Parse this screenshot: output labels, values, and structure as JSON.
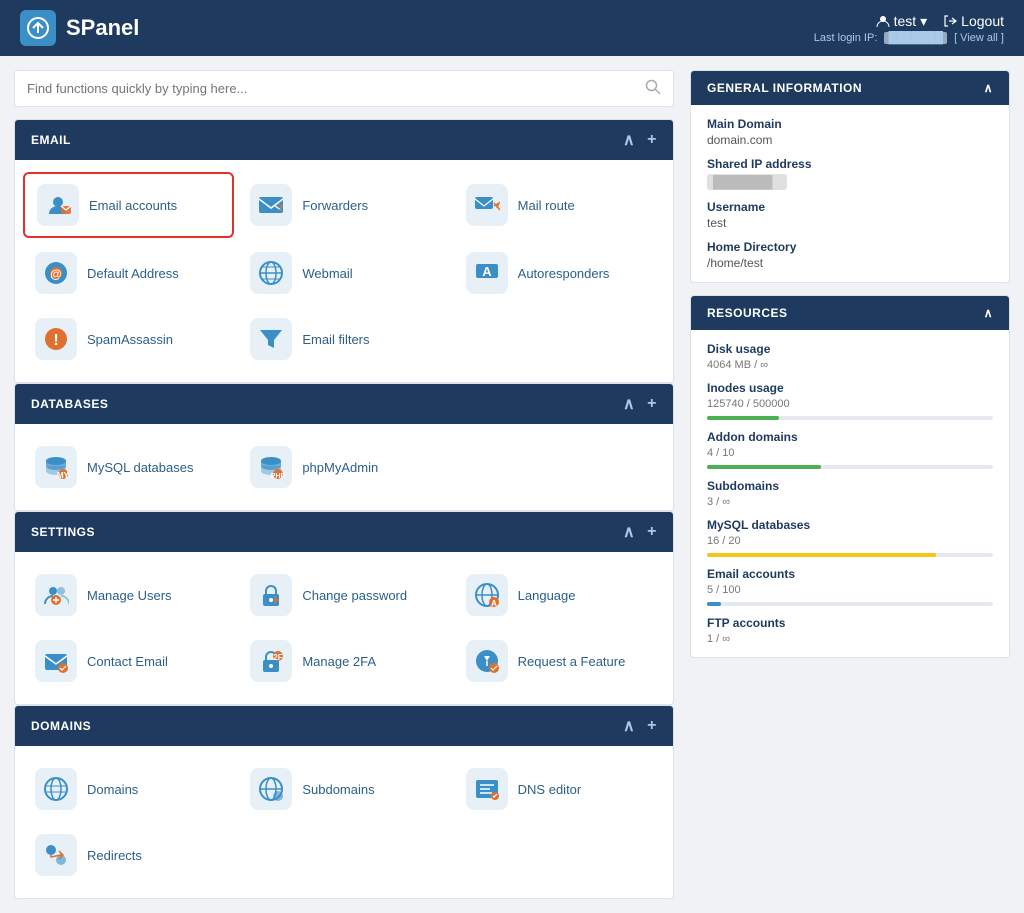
{
  "header": {
    "logo_text": "SPanel",
    "user_label": "test",
    "logout_label": "Logout",
    "last_login_prefix": "Last login IP:",
    "last_login_ip": "███████",
    "view_all_label": "[ View all ]"
  },
  "search": {
    "placeholder": "Find functions quickly by typing here..."
  },
  "sections": [
    {
      "id": "email",
      "title": "EMAIL",
      "items": [
        {
          "id": "email-accounts",
          "label": "Email accounts",
          "icon": "📧",
          "highlighted": true
        },
        {
          "id": "forwarders",
          "label": "Forwarders",
          "icon": "✉️",
          "highlighted": false
        },
        {
          "id": "mail-route",
          "label": "Mail route",
          "icon": "📨",
          "highlighted": false
        },
        {
          "id": "default-address",
          "label": "Default Address",
          "icon": "📬",
          "highlighted": false
        },
        {
          "id": "webmail",
          "label": "Webmail",
          "icon": "🌐",
          "highlighted": false
        },
        {
          "id": "autoresponders",
          "label": "Autoresponders",
          "icon": "🅰️",
          "highlighted": false
        },
        {
          "id": "spamassassin",
          "label": "SpamAssassin",
          "icon": "⚠️",
          "highlighted": false
        },
        {
          "id": "email-filters",
          "label": "Email filters",
          "icon": "🔽",
          "highlighted": false
        }
      ]
    },
    {
      "id": "databases",
      "title": "DATABASES",
      "items": [
        {
          "id": "mysql-databases",
          "label": "MySQL databases",
          "icon": "🗄️",
          "highlighted": false
        },
        {
          "id": "phpmyadmin",
          "label": "phpMyAdmin",
          "icon": "🛢️",
          "highlighted": false
        }
      ]
    },
    {
      "id": "settings",
      "title": "SETTINGS",
      "items": [
        {
          "id": "manage-users",
          "label": "Manage Users",
          "icon": "👤",
          "highlighted": false
        },
        {
          "id": "change-password",
          "label": "Change password",
          "icon": "🔒",
          "highlighted": false
        },
        {
          "id": "language",
          "label": "Language",
          "icon": "🌐",
          "highlighted": false
        },
        {
          "id": "contact-email",
          "label": "Contact Email",
          "icon": "📧",
          "highlighted": false
        },
        {
          "id": "manage-2fa",
          "label": "Manage 2FA",
          "icon": "🔐",
          "highlighted": false
        },
        {
          "id": "request-feature",
          "label": "Request a Feature",
          "icon": "💡",
          "highlighted": false
        }
      ]
    },
    {
      "id": "domains",
      "title": "DOMAINS",
      "items": [
        {
          "id": "domains",
          "label": "Domains",
          "icon": "🌐",
          "highlighted": false
        },
        {
          "id": "subdomains",
          "label": "Subdomains",
          "icon": "🌐",
          "highlighted": false
        },
        {
          "id": "dns-editor",
          "label": "DNS editor",
          "icon": "📝",
          "highlighted": false
        },
        {
          "id": "redirects",
          "label": "Redirects",
          "icon": "🔀",
          "highlighted": false
        }
      ]
    }
  ],
  "general_info": {
    "title": "GENERAL INFORMATION",
    "rows": [
      {
        "label": "Main Domain",
        "value": "domain.com",
        "blurred": false
      },
      {
        "label": "Shared IP address",
        "value": "███████",
        "blurred": true
      },
      {
        "label": "Username",
        "value": "test",
        "blurred": false
      },
      {
        "label": "Home Directory",
        "value": "/home/test",
        "blurred": false
      }
    ]
  },
  "resources": {
    "title": "RESOURCES",
    "rows": [
      {
        "label": "Disk usage",
        "value": "4064 MB / ∞",
        "bar": false,
        "bar_pct": 0,
        "bar_color": ""
      },
      {
        "label": "Inodes usage",
        "value": "125740 / 500000",
        "bar": true,
        "bar_pct": 25,
        "bar_color": "bar-green"
      },
      {
        "label": "Addon domains",
        "value": "4 / 10",
        "bar": true,
        "bar_pct": 40,
        "bar_color": "bar-green"
      },
      {
        "label": "Subdomains",
        "value": "3 / ∞",
        "bar": false,
        "bar_pct": 0,
        "bar_color": ""
      },
      {
        "label": "MySQL databases",
        "value": "16 / 20",
        "bar": true,
        "bar_pct": 80,
        "bar_color": "bar-yellow"
      },
      {
        "label": "Email accounts",
        "value": "5 / 100",
        "bar": true,
        "bar_pct": 5,
        "bar_color": "bar-blue"
      },
      {
        "label": "FTP accounts",
        "value": "1 / ∞",
        "bar": false,
        "bar_pct": 0,
        "bar_color": ""
      }
    ]
  },
  "icons": {
    "chevron_up": "∧",
    "plus": "+",
    "search": "🔍",
    "collapse": "^"
  }
}
